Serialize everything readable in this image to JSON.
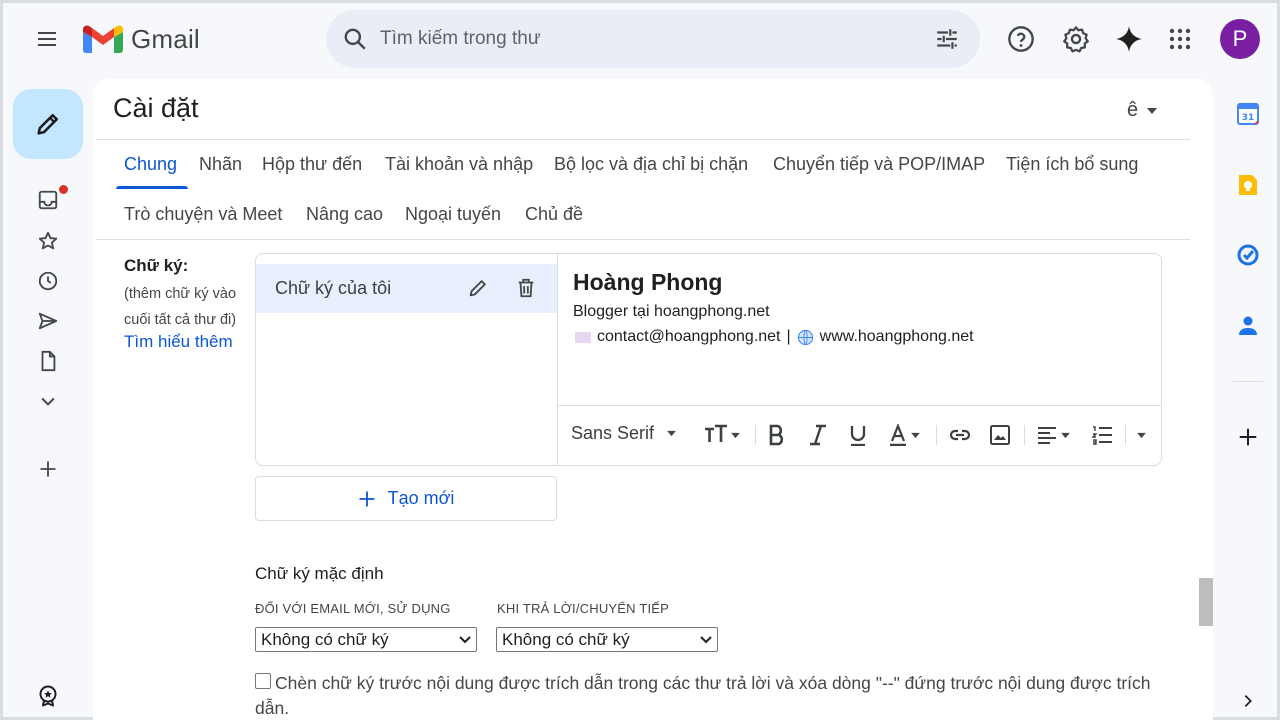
{
  "app": {
    "name": "Gmail"
  },
  "search": {
    "placeholder": "Tìm kiếm trong thư"
  },
  "user": {
    "avatar_letter": "P",
    "avatar_color": "#7b1fa2"
  },
  "page": {
    "title": "Cài đặt",
    "lang_glyph": "ê"
  },
  "tabs": [
    {
      "label": "Chung",
      "active": true
    },
    {
      "label": "Nhãn"
    },
    {
      "label": "Hộp thư đến"
    },
    {
      "label": "Tài khoản và nhập"
    },
    {
      "label": "Bộ lọc và địa chỉ bị chặn"
    },
    {
      "label": "Chuyển tiếp và POP/IMAP"
    },
    {
      "label": "Tiện ích bổ sung"
    },
    {
      "label": "Trò chuyện và Meet"
    },
    {
      "label": "Nâng cao"
    },
    {
      "label": "Ngoại tuyến"
    },
    {
      "label": "Chủ đề"
    }
  ],
  "signature": {
    "label": "Chữ ký:",
    "description": "(thêm chữ ký vào cuối tất cả thư đi)",
    "learn_more": "Tìm hiểu thêm",
    "items": [
      {
        "name": "Chữ ký của tôi"
      }
    ],
    "content": {
      "name": "Hoàng Phong",
      "role": "Blogger tại hoangphong.net",
      "email": "contact@hoangphong.net",
      "separator": "|",
      "website": "www.hoangphong.net"
    },
    "font": "Sans Serif",
    "new_button": "Tạo mới"
  },
  "defaults": {
    "title": "Chữ ký mặc định",
    "new_email_caption": "ĐỐI VỚI EMAIL MỚI, SỬ DỤNG",
    "new_email_value": "Không có chữ ký",
    "reply_caption": "KHI TRẢ LỜI/CHUYỂN TIẾP",
    "reply_value": "Không có chữ ký",
    "checkbox_label": "Chèn chữ ký trước nội dung được trích dẫn trong các thư trả lời và xóa dòng \"--\" đứng trước nội dung được trích dẫn."
  },
  "colors": {
    "accent": "#0b57d0",
    "compose_bg": "#c2e7ff",
    "badge": "#d93025"
  }
}
